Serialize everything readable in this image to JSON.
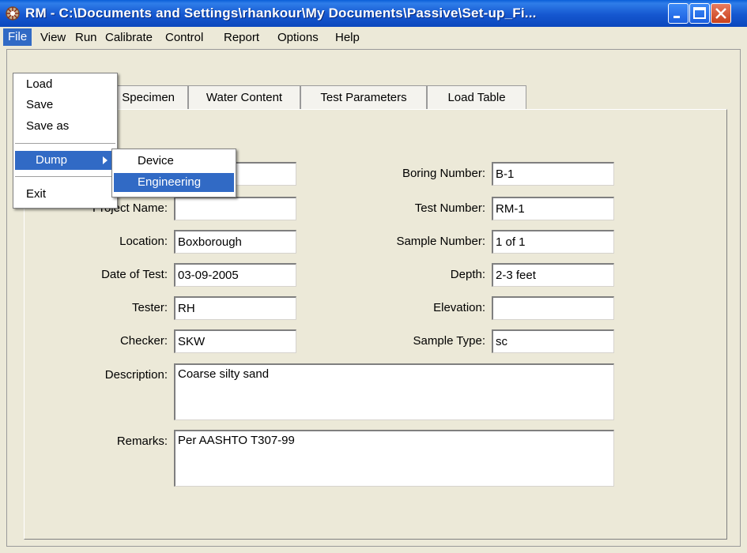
{
  "window": {
    "title": "RM - C:\\Documents and Settings\\rhankour\\My Documents\\Passive\\Set-up_Fi..."
  },
  "menubar": [
    "File",
    "View",
    "Run",
    "Calibrate",
    "Control",
    "Report",
    "Options",
    "Help"
  ],
  "file_menu": {
    "items": [
      "Load",
      "Save",
      "Save as",
      "Dump",
      "Exit"
    ],
    "highlighted": "Dump"
  },
  "dump_submenu": {
    "items": [
      "Device",
      "Engineering"
    ],
    "highlighted": "Engineering"
  },
  "tabs": [
    "Specimen",
    "Water Content",
    "Test Parameters",
    "Load Table"
  ],
  "form": {
    "project_name": {
      "label": "Project Name:",
      "value": ""
    },
    "location": {
      "label": "Location:",
      "value": "Boxborough"
    },
    "date_of_test": {
      "label": "Date of Test:",
      "value": "03-09-2005"
    },
    "tester": {
      "label": "Tester:",
      "value": "RH"
    },
    "checker": {
      "label": "Checker:",
      "value": "SKW"
    },
    "boring_number": {
      "label": "Boring Number:",
      "value": "B-1"
    },
    "test_number": {
      "label": "Test Number:",
      "value": "RM-1"
    },
    "sample_number": {
      "label": "Sample Number:",
      "value": "1 of 1"
    },
    "depth": {
      "label": "Depth:",
      "value": "2-3 feet"
    },
    "elevation": {
      "label": "Elevation:",
      "value": ""
    },
    "sample_type": {
      "label": "Sample Type:",
      "value": "sc"
    },
    "description": {
      "label": "Description:",
      "value": "Coarse silty sand"
    },
    "remarks": {
      "label": "Remarks:",
      "value": "Per AASHTO T307-99"
    }
  },
  "colors": {
    "titlebar": "#0b47bd",
    "highlight": "#316ac5",
    "window_bg": "#ece9d8"
  }
}
